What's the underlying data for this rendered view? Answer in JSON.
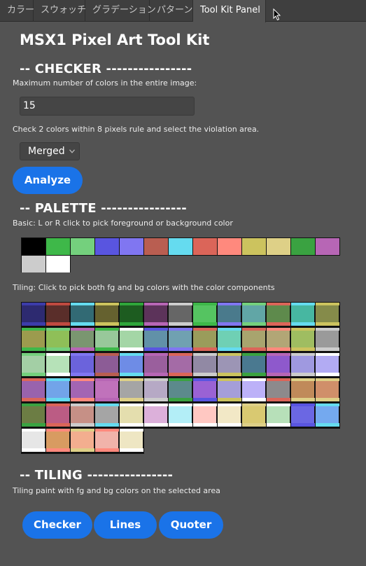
{
  "tabs": [
    "カラー",
    "スウォッチ",
    "グラデーション",
    "パターン",
    "Tool Kit Panel"
  ],
  "active_tab": "Tool Kit Panel",
  "panel": {
    "title": "MSX1 Pixel Art Tool Kit"
  },
  "checker": {
    "heading": "-- CHECKER ----------------",
    "max_colors_desc": "Maximum number of colors in the entire image:",
    "max_colors_value": "15",
    "rule_desc": "Check 2 colors within 8 pixels rule and select the violation area.",
    "mode_selected": "Merged",
    "analyze_label": "Analyze"
  },
  "palette": {
    "heading": "-- PALETTE ----------------",
    "basic_desc": "Basic: L or R click to pick foreground or background color",
    "basic_colors": [
      "#000000",
      "#3eb849",
      "#74d07d",
      "#5955e0",
      "#8076f1",
      "#b95e51",
      "#65dbef",
      "#db6559",
      "#ff897d",
      "#ccc35e",
      "#ded087",
      "#3aa241",
      "#b766b5",
      "#cccccc",
      "#ffffff"
    ],
    "tiling_desc": "Tiling: Click to pick both fg and bg colors with the color components",
    "tiling_colors": [
      [
        "#2d2a70",
        "#5a2e2a",
        "#326a74",
        "#65612f",
        "#1d5c20",
        "#5c335a",
        "#666666",
        "#55c461",
        "#4a7a8c",
        "#61a6a6",
        "#5e8a4c",
        "#47b7a1",
        "#858b4a"
      ],
      [
        "#9c9b4e",
        "#8fbf58",
        "#7a9670",
        "#98c89a",
        "#a4d6a6",
        "#6191a8",
        "#70a1b1",
        "#9a9c5b",
        "#6fd0b4",
        "#a8a46e",
        "#b2a676",
        "#9fbd61",
        "#9a9a9a"
      ],
      [
        "#a3cfa5",
        "#b6e2b8",
        "#6b63dc",
        "#8c5c96",
        "#6e8ce6",
        "#9a5f9d",
        "#a46ba6",
        "#9189a4",
        "#9c95b5",
        "#4a7990",
        "#8e59cc",
        "#9f99e0",
        "#b2abf3"
      ],
      [
        "#9963ad",
        "#72a4e9",
        "#a365b3",
        "#c072bb",
        "#a5a5a5",
        "#b6a9c5",
        "#5c8a8c",
        "#9a62d4",
        "#a59ed9",
        "#bcb1f8",
        "#8d8a8c",
        "#c08a5a",
        "#d08f6a"
      ],
      [
        "#6c7d44",
        "#bb5c84",
        "#c69086",
        "#a5a5a5",
        "#e4deae",
        "#dcb0da",
        "#b3eef7",
        "#ffc8c2",
        "#f2e8c6",
        "#d9c971",
        "#b7e0b9",
        "#6b67e3",
        "#74a9ef"
      ],
      [
        "#e6e6e6",
        "#d89b61",
        "#f3ae8f",
        "#f1b3aa",
        "#eee6c3"
      ]
    ],
    "tiling_accents": [
      [
        "#3c3caa",
        "#c04a40",
        "#65dbef",
        "#ccc35e",
        "#2fa63a",
        "#b766b5",
        "#cccccc",
        "#3eb849",
        "#8076f1",
        "#74d07d",
        "#db6559",
        "#65dbef",
        "#ccc35e"
      ],
      [
        "#3eb849",
        "#74d07d",
        "#b766b5",
        "#3eb849",
        "#ffffff",
        "#5955e0",
        "#8076f1",
        "#db6559",
        "#65dbef",
        "#db6559",
        "#ff897d",
        "#ccc35e",
        "#cccccc"
      ],
      [
        "#74d07d",
        "#ffffff",
        "#8076f1",
        "#b95e51",
        "#65dbef",
        "#b766b5",
        "#db6559",
        "#cccccc",
        "#ccc35e",
        "#3aa241",
        "#b766b5",
        "#cccccc",
        "#ffffff"
      ],
      [
        "#db6559",
        "#65dbef",
        "#ff897d",
        "#b766b5",
        "#ded087",
        "#cccccc",
        "#3aa241",
        "#5955e0",
        "#ccc35e",
        "#ffffff",
        "#db6559",
        "#ded087",
        "#ded087"
      ],
      [
        "#3aa241",
        "#db6559",
        "#cccccc",
        "#65dbef",
        "#ffffff",
        "#ffffff",
        "#ffffff",
        "#ffffff",
        "#ffffff",
        "#ded087",
        "#ffffff",
        "#5955e0",
        "#65dbef"
      ],
      [
        "#ffffff",
        "#ff897d",
        "#ded087",
        "#ff897d",
        "#ffffff"
      ]
    ]
  },
  "tiling": {
    "heading": "-- TILING ----------------",
    "desc": "Tiling paint with fg and bg colors on the selected area",
    "buttons": [
      "Checker",
      "Lines",
      "Quoter"
    ]
  }
}
